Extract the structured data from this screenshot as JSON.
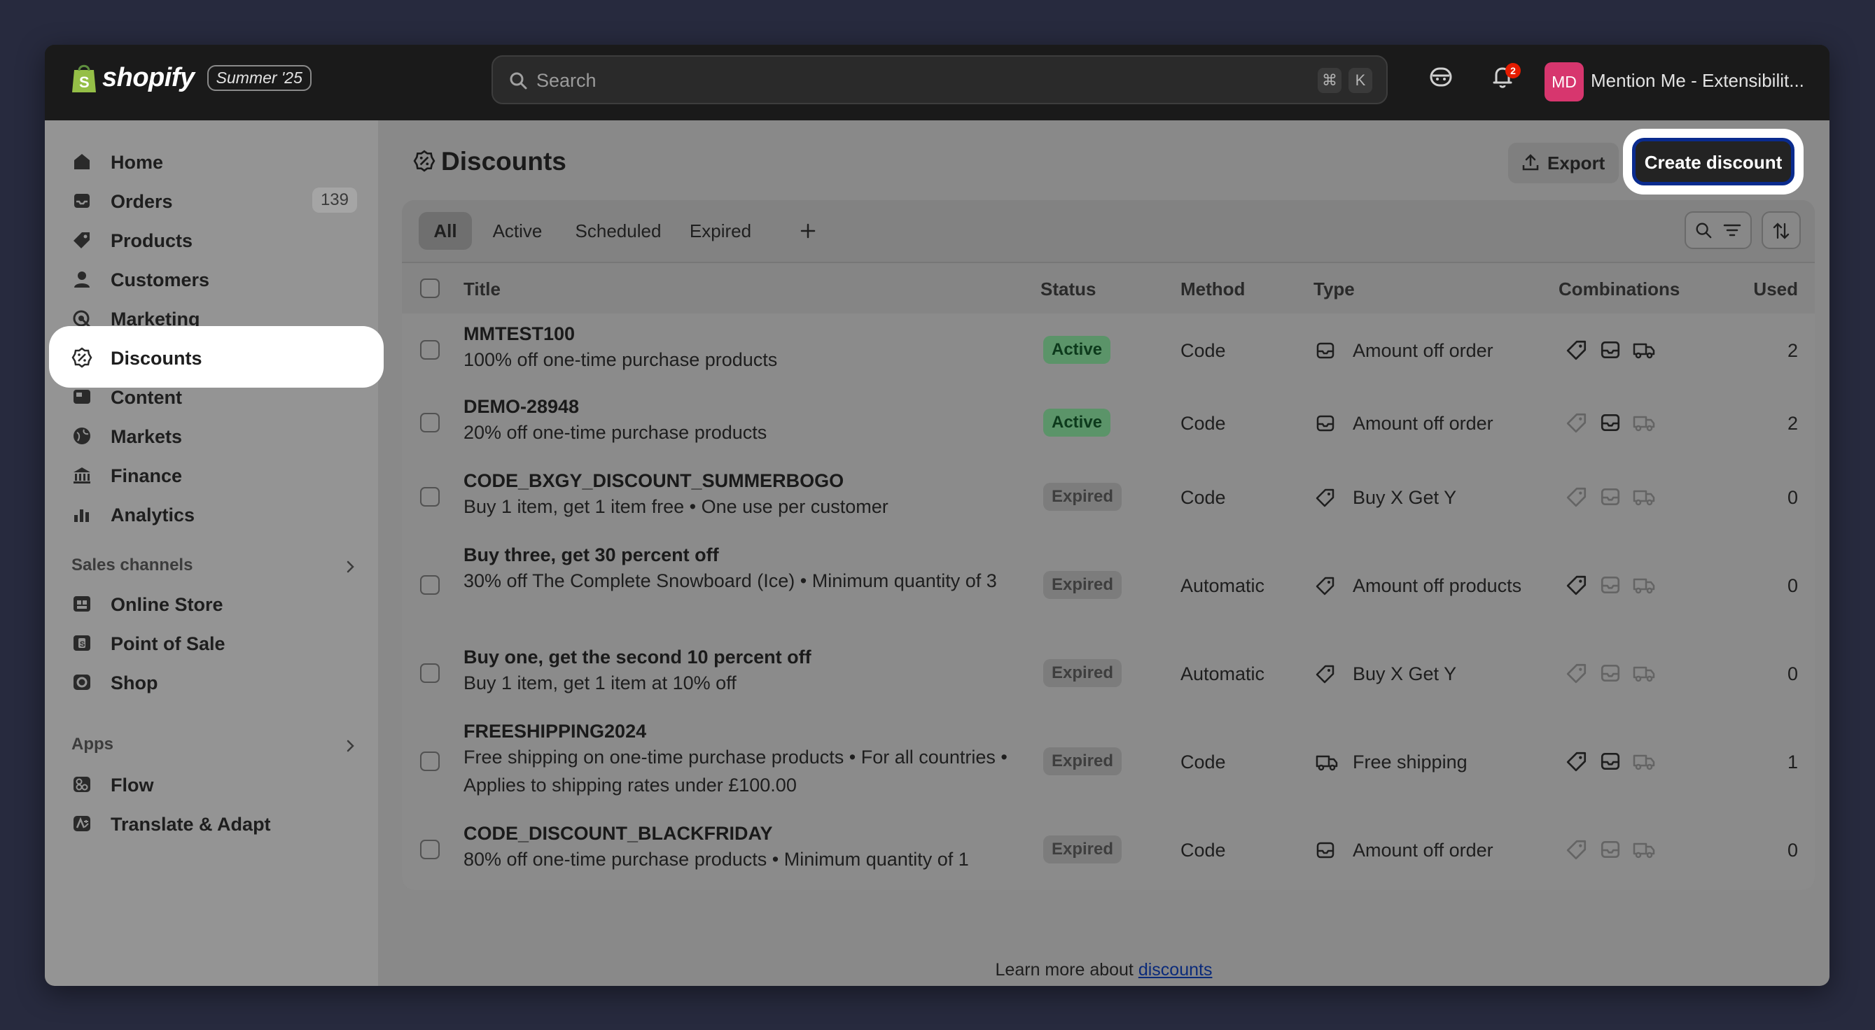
{
  "topbar": {
    "brand": "shopify",
    "edition": "Summer '25",
    "search_placeholder": "Search",
    "shortcut_keys": [
      "⌘",
      "K"
    ],
    "notification_count": "2",
    "avatar_initials": "MD",
    "store_name": "Mention Me - Extensibilit..."
  },
  "sidebar": {
    "items": [
      {
        "label": "Home",
        "icon": "home-icon"
      },
      {
        "label": "Orders",
        "icon": "inbox-icon",
        "count": "139"
      },
      {
        "label": "Products",
        "icon": "tag-icon"
      },
      {
        "label": "Customers",
        "icon": "person-icon"
      },
      {
        "label": "Marketing",
        "icon": "target-icon"
      },
      {
        "label": "Discounts",
        "icon": "discount-icon",
        "selected": true
      },
      {
        "label": "Content",
        "icon": "content-icon"
      },
      {
        "label": "Markets",
        "icon": "globe-icon"
      },
      {
        "label": "Finance",
        "icon": "bank-icon"
      },
      {
        "label": "Analytics",
        "icon": "bar-chart-icon"
      }
    ],
    "sales_channels_label": "Sales channels",
    "sales_channels": [
      {
        "label": "Online Store",
        "icon": "store-icon"
      },
      {
        "label": "Point of Sale",
        "icon": "pos-icon"
      },
      {
        "label": "Shop",
        "icon": "shop-icon"
      }
    ],
    "apps_label": "Apps",
    "apps": [
      {
        "label": "Flow",
        "icon": "flow-icon"
      },
      {
        "label": "Translate & Adapt",
        "icon": "translate-icon"
      }
    ]
  },
  "page": {
    "title": "Discounts",
    "export_label": "Export",
    "create_label": "Create discount"
  },
  "tabs": [
    "All",
    "Active",
    "Scheduled",
    "Expired"
  ],
  "table": {
    "headers": {
      "title": "Title",
      "status": "Status",
      "method": "Method",
      "type": "Type",
      "combinations": "Combinations",
      "used": "Used"
    },
    "rows": [
      {
        "title": "MMTEST100",
        "desc": "100% off one-time purchase products",
        "status": "Active",
        "method": "Code",
        "type": "Amount off order",
        "type_icon": "order-icon",
        "combos": [
          true,
          true,
          true
        ],
        "used": "2"
      },
      {
        "title": "DEMO-28948",
        "desc": "20% off one-time purchase products",
        "status": "Active",
        "method": "Code",
        "type": "Amount off order",
        "type_icon": "order-icon",
        "combos": [
          false,
          true,
          false
        ],
        "used": "2"
      },
      {
        "title": "CODE_BXGY_DISCOUNT_SUMMERBOGO",
        "desc": "Buy 1 item, get 1 item free • One use per customer",
        "status": "Expired",
        "method": "Code",
        "type": "Buy X Get Y",
        "type_icon": "tag-icon",
        "combos": [
          false,
          false,
          false
        ],
        "used": "0"
      },
      {
        "title": "Buy three, get 30 percent off",
        "desc": "30% off The Complete Snowboard (Ice) • Minimum quantity of 3",
        "status": "Expired",
        "method": "Automatic",
        "type": "Amount off products",
        "type_icon": "tag-icon",
        "combos": [
          true,
          false,
          false
        ],
        "used": "0"
      },
      {
        "title": "Buy one, get the second 10 percent off",
        "desc": "Buy 1 item, get 1 item at 10% off",
        "status": "Expired",
        "method": "Automatic",
        "type": "Buy X Get Y",
        "type_icon": "tag-icon",
        "combos": [
          false,
          false,
          false
        ],
        "used": "0"
      },
      {
        "title": "FREESHIPPING2024",
        "desc": "Free shipping on one-time purchase products • For all countries • Applies to shipping rates under £100.00",
        "status": "Expired",
        "method": "Code",
        "type": "Free shipping",
        "type_icon": "truck-icon",
        "combos": [
          true,
          true,
          false
        ],
        "used": "1"
      },
      {
        "title": "CODE_DISCOUNT_BLACKFRIDAY",
        "desc": "80% off one-time purchase products • Minimum quantity of 1",
        "status": "Expired",
        "method": "Code",
        "type": "Amount off order",
        "type_icon": "order-icon",
        "combos": [
          false,
          false,
          false
        ],
        "used": "0"
      }
    ]
  },
  "footer": {
    "text": "Learn more about ",
    "link": "discounts"
  }
}
